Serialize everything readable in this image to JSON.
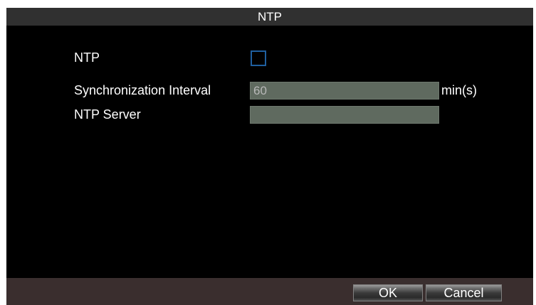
{
  "dialog": {
    "title": "NTP"
  },
  "form": {
    "ntp_label": "NTP",
    "ntp_enabled": false,
    "sync_interval_label": "Synchronization Interval",
    "sync_interval_value": "60",
    "sync_interval_unit": "min(s)",
    "ntp_server_label": "NTP Server",
    "ntp_server_value": ""
  },
  "buttons": {
    "ok_label": "OK",
    "cancel_label": "Cancel"
  },
  "colors": {
    "title_bar": "#303030",
    "content_bg": "#000000",
    "field_bg": "#5f6a5f",
    "checkbox_border": "#1f5f9f",
    "bottom_bar": "#3a2e2e"
  }
}
